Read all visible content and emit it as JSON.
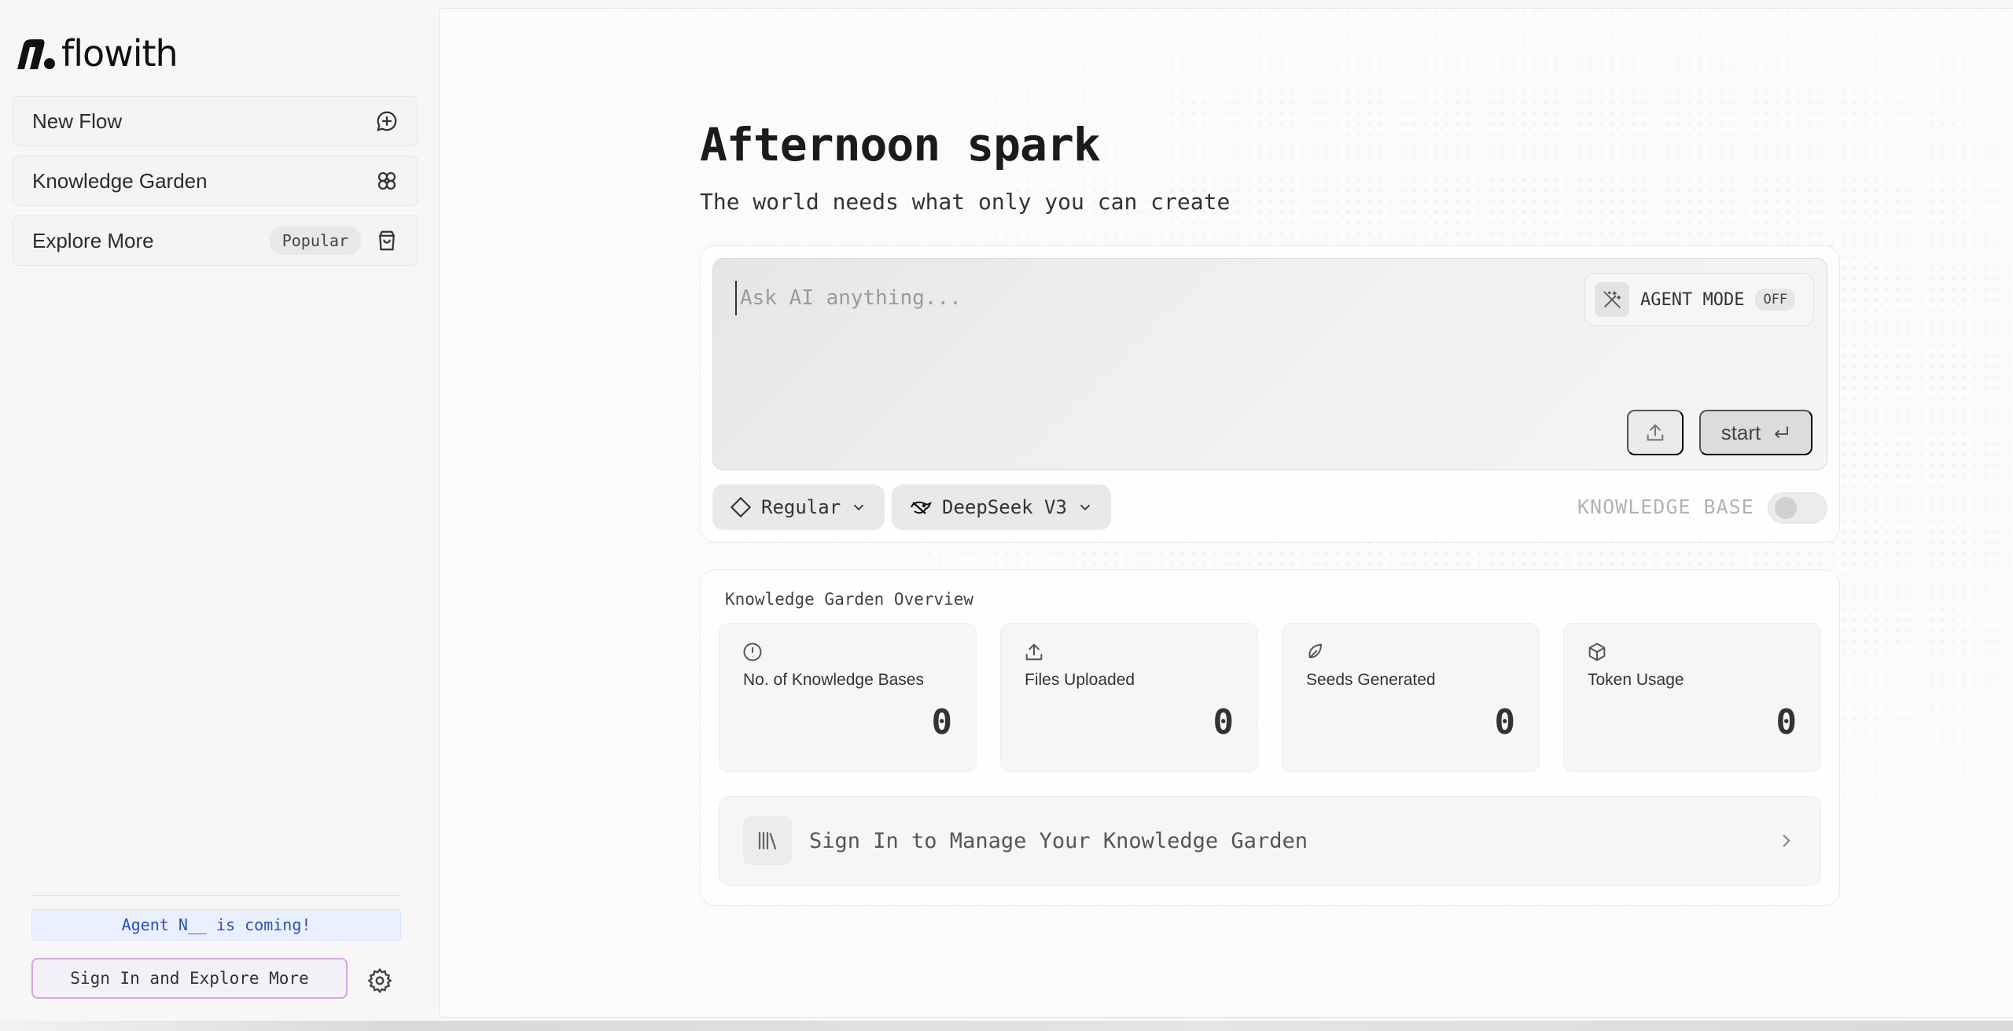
{
  "app": {
    "name": "flowith"
  },
  "sidebar": {
    "items": [
      {
        "label": "New Flow",
        "icon": "chat-plus-icon"
      },
      {
        "label": "Knowledge Garden",
        "icon": "flower-icon"
      },
      {
        "label": "Explore More",
        "badge": "Popular",
        "icon": "shopping-bag-icon"
      }
    ],
    "banner": "Agent N__ is coming!",
    "signin_label": "Sign In and Explore More",
    "settings_icon": "gear-icon"
  },
  "main": {
    "heading": "Afternoon spark",
    "subheading": "The world needs what only you can create",
    "composer": {
      "placeholder": "Ask AI anything...",
      "agent_mode_label": "AGENT MODE",
      "agent_mode_state": "OFF",
      "start_label": "start"
    },
    "mode_selector": {
      "value": "Regular"
    },
    "model_selector": {
      "value": "DeepSeek V3"
    },
    "knowledge_base_label": "KNOWLEDGE BASE",
    "knowledge_garden": {
      "title": "Knowledge Garden Overview",
      "stats": [
        {
          "label": "No. of Knowledge Bases",
          "value": "0",
          "icon": "info-circle-icon"
        },
        {
          "label": "Files Uploaded",
          "value": "0",
          "icon": "upload-icon"
        },
        {
          "label": "Seeds Generated",
          "value": "0",
          "icon": "seed-icon"
        },
        {
          "label": "Token Usage",
          "value": "0",
          "icon": "cube-icon"
        }
      ],
      "signin_prompt": "Sign In to Manage Your Knowledge Garden"
    }
  },
  "colors": {
    "accent_border": "#d6a6e0",
    "banner_bg": "#e9effd",
    "banner_text": "#2b4fb8"
  }
}
